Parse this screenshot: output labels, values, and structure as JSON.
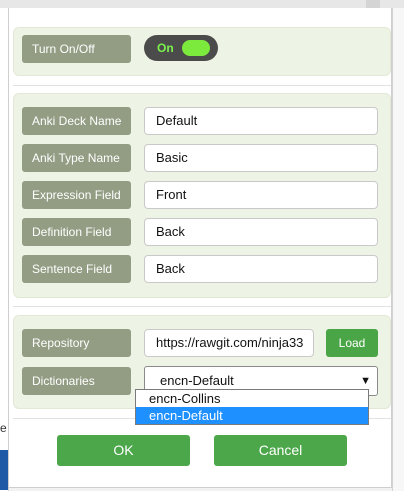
{
  "enable": {
    "label": "Turn On/Off",
    "toggle_text": "On"
  },
  "anki": {
    "fields": [
      {
        "label": "Anki Deck Name",
        "value": "Default"
      },
      {
        "label": "Anki Type Name",
        "value": "Basic"
      },
      {
        "label": "Expression Field",
        "value": "Front"
      },
      {
        "label": "Definition Field",
        "value": "Back"
      },
      {
        "label": "Sentence Field",
        "value": "Back"
      }
    ]
  },
  "dicts": {
    "repository_label": "Repository",
    "repository_value": "https://rawgit.com/ninja33",
    "load_label": "Load",
    "dictionaries_label": "Dictionaries",
    "selected": "encn-Default",
    "options": [
      "encn-Collins",
      "encn-Default"
    ]
  },
  "footer": {
    "ok_label": "OK",
    "cancel_label": "Cancel"
  },
  "background": {
    "left_edge_char": "e"
  },
  "icons": {
    "select_arrow": "triangle-down-icon"
  },
  "colors": {
    "panel_bg": "#eef4e5",
    "label_bg": "#939d84",
    "button_green": "#4ca74a",
    "toggle_bg": "#4b4b4b",
    "toggle_on": "#7bea3d",
    "highlight": "#1e90ff"
  }
}
